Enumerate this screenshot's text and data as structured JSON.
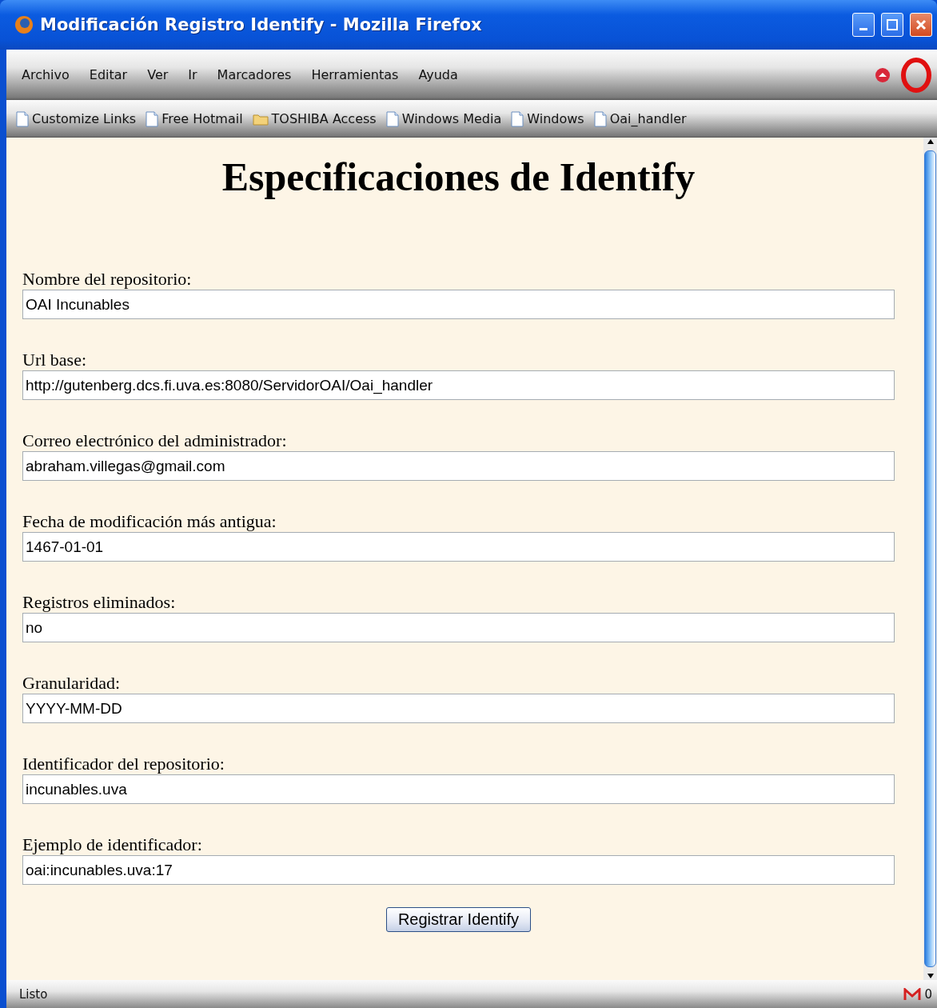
{
  "window": {
    "title": "Modificación Registro Identify - Mozilla Firefox"
  },
  "menu": [
    "Archivo",
    "Editar",
    "Ver",
    "Ir",
    "Marcadores",
    "Herramientas",
    "Ayuda"
  ],
  "bookmarks": [
    {
      "label": "Customize Links",
      "kind": "page"
    },
    {
      "label": "Free Hotmail",
      "kind": "page"
    },
    {
      "label": "TOSHIBA Access",
      "kind": "folder"
    },
    {
      "label": "Windows Media",
      "kind": "page"
    },
    {
      "label": "Windows",
      "kind": "page"
    },
    {
      "label": "Oai_handler",
      "kind": "page"
    }
  ],
  "heading": "Especificaciones de Identify",
  "fields": [
    {
      "label": "Nombre del repositorio:",
      "value": "OAI Incunables"
    },
    {
      "label": "Url base:",
      "value": "http://gutenberg.dcs.fi.uva.es:8080/ServidorOAI/Oai_handler"
    },
    {
      "label": "Correo electrónico del administrador:",
      "value": "abraham.villegas@gmail.com"
    },
    {
      "label": "Fecha de modificación más antigua:",
      "value": "1467-01-01"
    },
    {
      "label": "Registros eliminados:",
      "value": "no"
    },
    {
      "label": "Granularidad:",
      "value": "YYYY-MM-DD"
    },
    {
      "label": "Identificador del repositorio:",
      "value": "incunables.uva"
    },
    {
      "label": "Ejemplo de identificador:",
      "value": "oai:incunables.uva:17"
    }
  ],
  "submit": "Registrar Identify",
  "status_bar": {
    "text": "Listo",
    "mail_count": "0"
  }
}
